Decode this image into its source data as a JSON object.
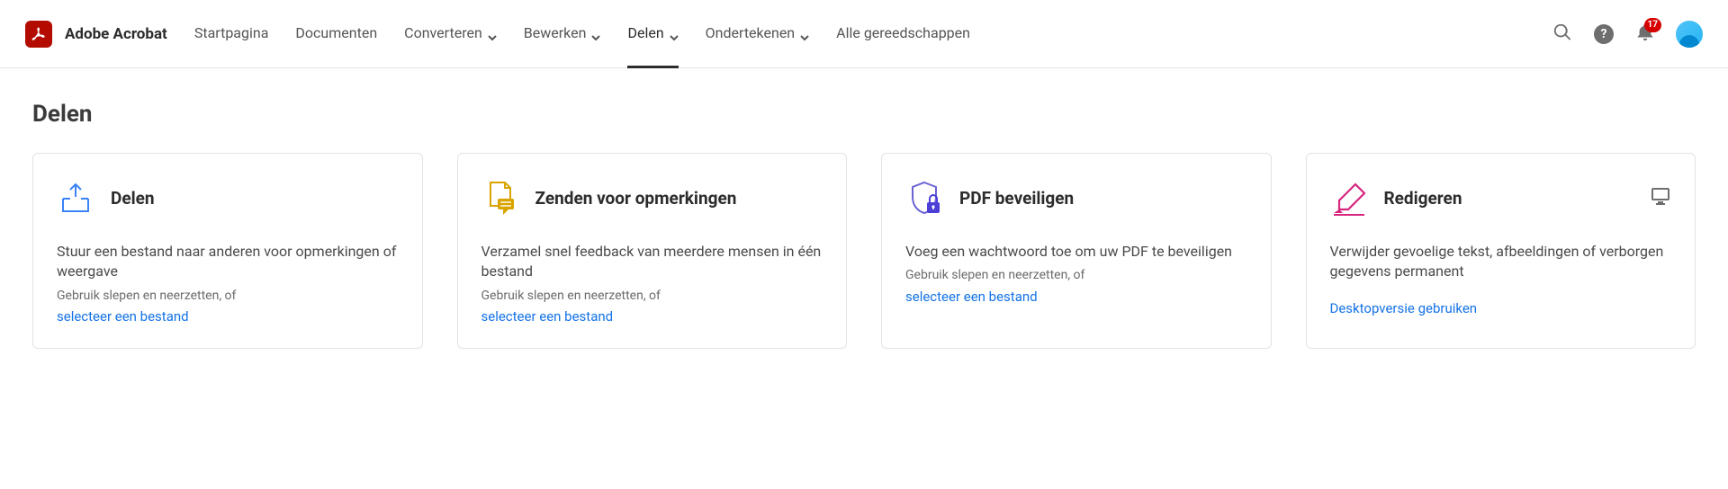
{
  "app": {
    "name": "Adobe Acrobat"
  },
  "nav": {
    "items": [
      {
        "label": "Startpagina",
        "dropdown": false,
        "active": false
      },
      {
        "label": "Documenten",
        "dropdown": false,
        "active": false
      },
      {
        "label": "Converteren",
        "dropdown": true,
        "active": false
      },
      {
        "label": "Bewerken",
        "dropdown": true,
        "active": false
      },
      {
        "label": "Delen",
        "dropdown": true,
        "active": true
      },
      {
        "label": "Ondertekenen",
        "dropdown": true,
        "active": false
      },
      {
        "label": "Alle gereedschappen",
        "dropdown": false,
        "active": false
      }
    ]
  },
  "header": {
    "notifications_count": "17"
  },
  "page": {
    "title": "Delen",
    "cards": [
      {
        "title": "Delen",
        "desc": "Stuur een bestand naar anderen voor opmerkingen of weergave",
        "hint": "Gebruik slepen en neerzetten, of",
        "link": "selecteer een bestand",
        "icon": "share-tray-icon"
      },
      {
        "title": "Zenden voor opmerkingen",
        "desc": "Verzamel snel feedback van meerdere mensen in één bestand",
        "hint": "Gebruik slepen en neerzetten, of",
        "link": "selecteer een bestand",
        "icon": "comment-doc-icon"
      },
      {
        "title": "PDF beveiligen",
        "desc": "Voeg een wachtwoord toe om uw PDF te beveiligen",
        "hint": "Gebruik slepen en neerzetten, of",
        "link": "selecteer een bestand",
        "icon": "shield-lock-icon"
      },
      {
        "title": "Redigeren",
        "desc": "Verwijder gevoelige tekst, afbeeldingen of verborgen gegevens permanent",
        "link": "Desktopversie gebruiken",
        "icon": "highlighter-icon",
        "desktop_only": true
      }
    ]
  },
  "colors": {
    "logo_bg": "#b30b00",
    "link": "#1473e6",
    "badge": "#d50000"
  }
}
